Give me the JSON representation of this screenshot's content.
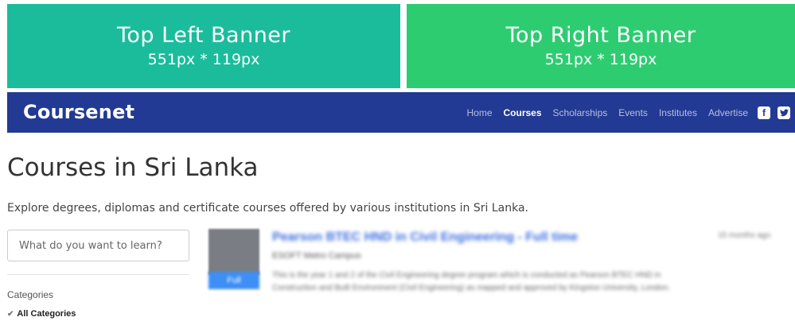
{
  "banners": {
    "left": {
      "title": "Top Left Banner",
      "size": "551px * 119px",
      "color": "#1abc9c"
    },
    "right": {
      "title": "Top Right Banner",
      "size": "551px * 119px",
      "color": "#2ecc71"
    }
  },
  "navbar": {
    "brand": "Coursenet",
    "background": "#233a94",
    "links": [
      "Home",
      "Courses",
      "Scholarships",
      "Events",
      "Institutes",
      "Advertise"
    ],
    "active_link": "Courses",
    "social_icons": [
      "facebook-icon",
      "twitter-icon"
    ]
  },
  "main": {
    "title": "Courses in Sri Lanka",
    "subtitle": "Explore degrees, diplomas and certificate courses offered by various institutions in Sri Lanka."
  },
  "sidebar": {
    "search_placeholder": "What do you want to learn?",
    "categories_label": "Categories",
    "categories": [
      {
        "label": "All Categories",
        "checked": true
      }
    ]
  },
  "results": [
    {
      "title": "Pearson BTEC HND in Civil Engineering - Full time",
      "institution": "ESOFT Metro Campus",
      "tag": "Full",
      "time": "15 months ago",
      "description": "This is the year 1 and 2 of the Civil Engineering degree program which is conducted as Pearson BTEC HND in Construction and Built Environment (Civil Engineering) as mapped and approved by Kingston University, London."
    }
  ]
}
